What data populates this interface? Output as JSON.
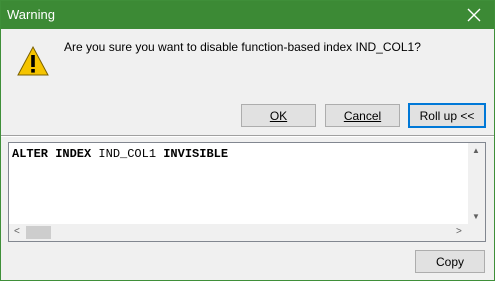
{
  "window": {
    "title": "Warning",
    "close_glyph": "✕"
  },
  "message": {
    "text": "Are you sure you want to disable function-based index IND_COL1?",
    "icon": "warning-icon"
  },
  "buttons": {
    "ok": "OK",
    "cancel": "Cancel",
    "rollup": "Roll up <<",
    "copy": "Copy"
  },
  "sql": {
    "kw1": "ALTER INDEX",
    "name": "IND_COL1",
    "kw2": "INVISIBLE"
  },
  "scrollbars": {
    "up": "▲",
    "down": "▼",
    "left": "<",
    "right": ">"
  },
  "colors": {
    "titlebar": "#3c8a35",
    "default_button_border": "#0078d7",
    "warning_yellow": "#f5c400"
  }
}
